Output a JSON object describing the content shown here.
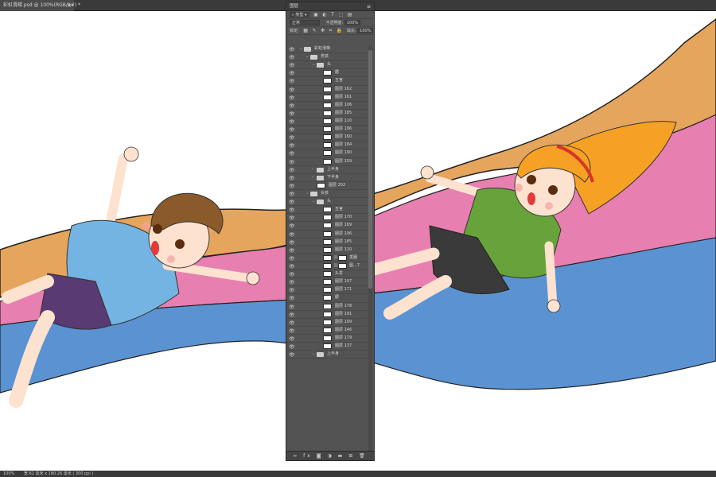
{
  "document": {
    "tab_title": "彩虹滑梯.psd @ 100%(RGB/8#) *",
    "close_glyph": "×"
  },
  "status": {
    "zoom": "100%",
    "doc_info": "宽:62 毫米 x 180.26 毫米 ( 300 ppi )"
  },
  "layers_panel": {
    "title": "图层",
    "filter_kind": "类型",
    "blend_mode": "正常",
    "opacity_label": "不透明度:",
    "opacity_value": "100%",
    "lock_label": "锁定:",
    "fill_label": "填充:",
    "fill_value": "100%",
    "layers": [
      {
        "name": "彩虹滑梯",
        "type": "group",
        "depth": 0,
        "expanded": true
      },
      {
        "name": "男孩",
        "type": "group",
        "depth": 1,
        "expanded": true
      },
      {
        "name": "头",
        "type": "group",
        "depth": 2,
        "expanded": true
      },
      {
        "name": "腮",
        "type": "layer",
        "depth": 3
      },
      {
        "name": "五官",
        "type": "layer",
        "depth": 3
      },
      {
        "name": "图层 162",
        "type": "layer",
        "depth": 3
      },
      {
        "name": "图层 161",
        "type": "layer",
        "depth": 3
      },
      {
        "name": "图层 106",
        "type": "layer",
        "depth": 3
      },
      {
        "name": "图层 185",
        "type": "layer",
        "depth": 3
      },
      {
        "name": "图层 110",
        "type": "layer",
        "depth": 3
      },
      {
        "name": "图层 196",
        "type": "layer",
        "depth": 3
      },
      {
        "name": "图层 160",
        "type": "layer",
        "depth": 3
      },
      {
        "name": "图层 184",
        "type": "layer",
        "depth": 3
      },
      {
        "name": "图层 190",
        "type": "layer",
        "depth": 3
      },
      {
        "name": "图层 159",
        "type": "layer",
        "depth": 3
      },
      {
        "name": "上半身",
        "type": "group",
        "depth": 2,
        "expanded": false
      },
      {
        "name": "下半身",
        "type": "group",
        "depth": 2,
        "expanded": false
      },
      {
        "name": "图层 202",
        "type": "layer",
        "depth": 2
      },
      {
        "name": "女孩",
        "type": "group",
        "depth": 1,
        "expanded": true
      },
      {
        "name": "头",
        "type": "group",
        "depth": 2,
        "expanded": true
      },
      {
        "name": "五官",
        "type": "layer",
        "depth": 3
      },
      {
        "name": "图层 170",
        "type": "layer",
        "depth": 3
      },
      {
        "name": "图层 169",
        "type": "layer",
        "depth": 3
      },
      {
        "name": "图层 106",
        "type": "layer",
        "depth": 3
      },
      {
        "name": "图层 185",
        "type": "layer",
        "depth": 3
      },
      {
        "name": "图层 110",
        "type": "layer",
        "depth": 3
      },
      {
        "name": "发圈",
        "type": "masked",
        "depth": 3
      },
      {
        "name": "图...7",
        "type": "masked",
        "depth": 3
      },
      {
        "name": "头发",
        "type": "layer",
        "depth": 3
      },
      {
        "name": "图层 197",
        "type": "layer",
        "depth": 3
      },
      {
        "name": "图层 171",
        "type": "layer",
        "depth": 3
      },
      {
        "name": "腮",
        "type": "layer",
        "depth": 3
      },
      {
        "name": "图层 178",
        "type": "layer",
        "depth": 3
      },
      {
        "name": "图层 191",
        "type": "layer",
        "depth": 3
      },
      {
        "name": "图层 109",
        "type": "layer",
        "depth": 3
      },
      {
        "name": "图层 146",
        "type": "layer",
        "depth": 3
      },
      {
        "name": "图层 179",
        "type": "layer",
        "depth": 3
      },
      {
        "name": "图层 137",
        "type": "layer",
        "depth": 3
      },
      {
        "name": "上半身",
        "type": "group",
        "depth": 2,
        "expanded": true
      }
    ],
    "footer_icons": [
      "link-icon",
      "fx-icon",
      "mask-icon",
      "adjustment-icon",
      "folder-icon",
      "new-layer-icon",
      "trash-icon"
    ]
  },
  "colors": {
    "slide_orange": "#e6a55d",
    "slide_pink": "#e77fb0",
    "slide_blue": "#5b93d2",
    "boy_shirt": "#74b4e2",
    "boy_shorts": "#5a3a72",
    "girl_shirt": "#67a33a",
    "girl_shorts": "#3a3a3a",
    "girl_hair": "#f7a124",
    "boy_hair": "#8b5a2b",
    "skin": "#fde2cf"
  }
}
